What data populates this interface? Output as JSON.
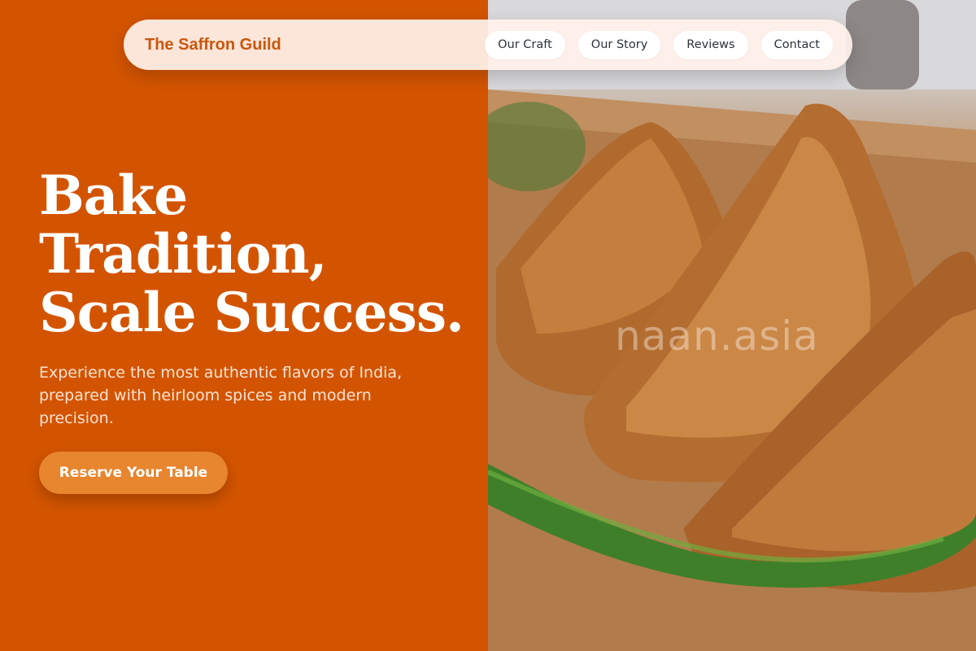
{
  "nav": {
    "brand": "The Saffron Guild",
    "links": [
      "Our Craft",
      "Our Story",
      "Reviews",
      "Contact"
    ]
  },
  "hero": {
    "title_lines": [
      "Bake",
      "Tradition,",
      "Scale Success."
    ],
    "subtitle": "Experience the most authentic flavors of India, prepared with heirloom spices and modern precision.",
    "cta_label": "Reserve Your Table"
  },
  "image": {
    "watermark": "naan.asia"
  },
  "colors": {
    "primary": "#d35400",
    "accent": "#e8852f",
    "brand_text": "#c9570d",
    "nav_bg": "#fff0ea"
  }
}
